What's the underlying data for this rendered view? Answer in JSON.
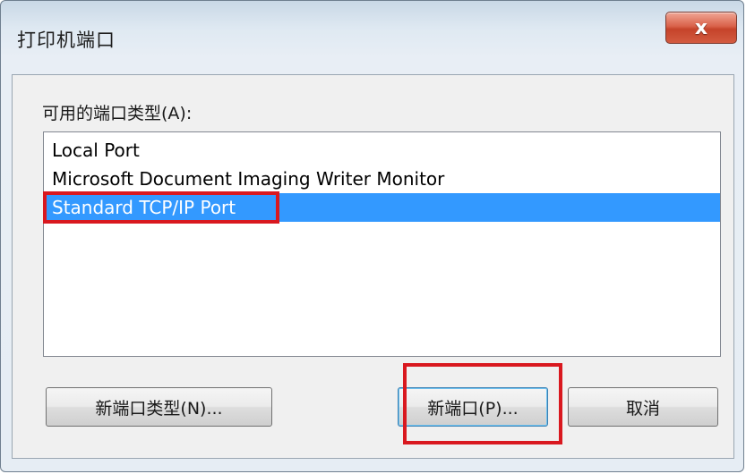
{
  "window": {
    "title": "打印机端口",
    "close_label": "x"
  },
  "group_label": "可用的端口类型(A):",
  "port_list": {
    "items": [
      {
        "label": "Local Port",
        "selected": false
      },
      {
        "label": "Microsoft Document Imaging Writer Monitor",
        "selected": false
      },
      {
        "label": "Standard TCP/IP Port",
        "selected": true
      }
    ]
  },
  "buttons": {
    "new_port_type": "新端口类型(N)...",
    "new_port": "新端口(P)...",
    "cancel": "取消"
  },
  "colors": {
    "selection": "#3399ff",
    "annotation_red": "#d9181f",
    "close_button": "#c5432a"
  }
}
